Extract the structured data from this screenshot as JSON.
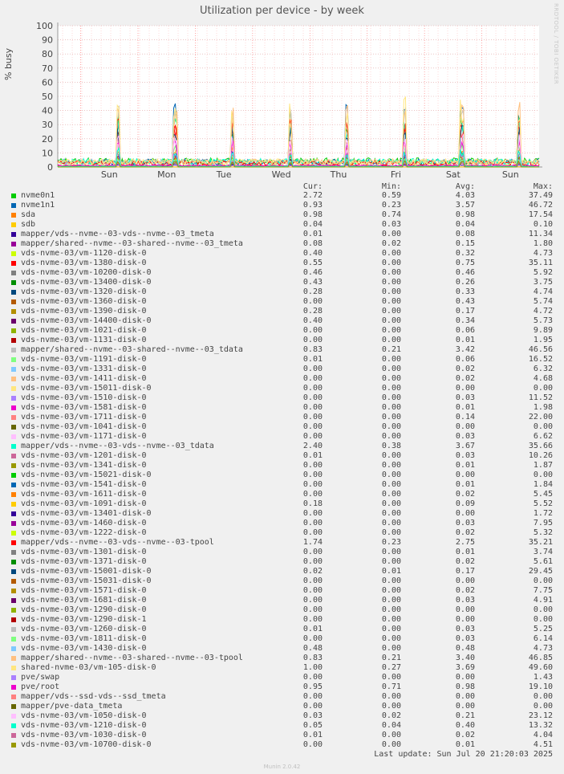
{
  "chart_data": {
    "type": "line",
    "title": "Utilization per device - by week",
    "ylabel": "% busy",
    "ylim": [
      0,
      100
    ],
    "yticks": [
      0,
      10,
      20,
      30,
      40,
      50,
      60,
      70,
      80,
      90,
      100
    ],
    "xticks": [
      "Sun",
      "Mon",
      "Tue",
      "Wed",
      "Thu",
      "Fri",
      "Sat",
      "Sun"
    ],
    "grid": true,
    "series": [
      {
        "name": "nvme0n1",
        "color": "#00cc00",
        "cur": "2.72",
        "min": "0.59",
        "avg": "4.03",
        "max": "37.49"
      },
      {
        "name": "nvme1n1",
        "color": "#0066b3",
        "cur": "0.93",
        "min": "0.23",
        "avg": "3.57",
        "max": "46.72"
      },
      {
        "name": "sda",
        "color": "#ff8000",
        "cur": "0.98",
        "min": "0.74",
        "avg": "0.98",
        "max": "17.54"
      },
      {
        "name": "sdb",
        "color": "#ffcc00",
        "cur": "0.04",
        "min": "0.03",
        "avg": "0.04",
        "max": "0.10"
      },
      {
        "name": "mapper/vds--nvme--03-vds--nvme--03_tmeta",
        "color": "#330099",
        "cur": "0.01",
        "min": "0.00",
        "avg": "0.08",
        "max": "11.34"
      },
      {
        "name": "mapper/shared--nvme--03-shared--nvme--03_tmeta",
        "color": "#990099",
        "cur": "0.08",
        "min": "0.02",
        "avg": "0.15",
        "max": "1.80"
      },
      {
        "name": "vds-nvme-03/vm-1120-disk-0",
        "color": "#ccff00",
        "cur": "0.40",
        "min": "0.00",
        "avg": "0.32",
        "max": "4.73"
      },
      {
        "name": "vds-nvme-03/vm-1380-disk-0",
        "color": "#ff0000",
        "cur": "0.55",
        "min": "0.00",
        "avg": "0.75",
        "max": "35.11"
      },
      {
        "name": "vds-nvme-03/vm-10200-disk-0",
        "color": "#808080",
        "cur": "0.46",
        "min": "0.00",
        "avg": "0.46",
        "max": "5.92"
      },
      {
        "name": "vds-nvme-03/vm-13400-disk-0",
        "color": "#008f00",
        "cur": "0.43",
        "min": "0.00",
        "avg": "0.26",
        "max": "3.75"
      },
      {
        "name": "vds-nvme-03/vm-1320-disk-0",
        "color": "#00487d",
        "cur": "0.28",
        "min": "0.00",
        "avg": "0.33",
        "max": "4.74"
      },
      {
        "name": "vds-nvme-03/vm-1360-disk-0",
        "color": "#b35a00",
        "cur": "0.00",
        "min": "0.00",
        "avg": "0.43",
        "max": "5.74"
      },
      {
        "name": "vds-nvme-03/vm-1390-disk-0",
        "color": "#b38f00",
        "cur": "0.28",
        "min": "0.00",
        "avg": "0.17",
        "max": "4.72"
      },
      {
        "name": "vds-nvme-03/vm-14400-disk-0",
        "color": "#6b006b",
        "cur": "0.40",
        "min": "0.00",
        "avg": "0.34",
        "max": "5.73"
      },
      {
        "name": "vds-nvme-03/vm-1021-disk-0",
        "color": "#8fb300",
        "cur": "0.00",
        "min": "0.00",
        "avg": "0.06",
        "max": "9.89"
      },
      {
        "name": "vds-nvme-03/vm-1131-disk-0",
        "color": "#b30000",
        "cur": "0.00",
        "min": "0.00",
        "avg": "0.01",
        "max": "1.95"
      },
      {
        "name": "mapper/shared--nvme--03-shared--nvme--03_tdata",
        "color": "#bebebe",
        "cur": "0.83",
        "min": "0.21",
        "avg": "3.42",
        "max": "46.56"
      },
      {
        "name": "vds-nvme-03/vm-1191-disk-0",
        "color": "#80ff80",
        "cur": "0.01",
        "min": "0.00",
        "avg": "0.06",
        "max": "16.52"
      },
      {
        "name": "vds-nvme-03/vm-1331-disk-0",
        "color": "#80c9ff",
        "cur": "0.00",
        "min": "0.00",
        "avg": "0.02",
        "max": "6.32"
      },
      {
        "name": "vds-nvme-03/vm-1411-disk-0",
        "color": "#ffc080",
        "cur": "0.00",
        "min": "0.00",
        "avg": "0.02",
        "max": "4.68"
      },
      {
        "name": "vds-nvme-03/vm-15011-disk-0",
        "color": "#ffe680",
        "cur": "0.00",
        "min": "0.00",
        "avg": "0.00",
        "max": "0.00"
      },
      {
        "name": "vds-nvme-03/vm-1510-disk-0",
        "color": "#aa80ff",
        "cur": "0.00",
        "min": "0.00",
        "avg": "0.03",
        "max": "11.52"
      },
      {
        "name": "vds-nvme-03/vm-1581-disk-0",
        "color": "#ee00cc",
        "cur": "0.00",
        "min": "0.00",
        "avg": "0.01",
        "max": "1.98"
      },
      {
        "name": "vds-nvme-03/vm-1711-disk-0",
        "color": "#ff8080",
        "cur": "0.00",
        "min": "0.00",
        "avg": "0.14",
        "max": "22.00"
      },
      {
        "name": "vds-nvme-03/vm-1041-disk-0",
        "color": "#666600",
        "cur": "0.00",
        "min": "0.00",
        "avg": "0.00",
        "max": "0.00"
      },
      {
        "name": "vds-nvme-03/vm-1171-disk-0",
        "color": "#ffbfff",
        "cur": "0.00",
        "min": "0.00",
        "avg": "0.03",
        "max": "6.62"
      },
      {
        "name": "mapper/vds--nvme--03-vds--nvme--03_tdata",
        "color": "#00ffcc",
        "cur": "2.40",
        "min": "0.38",
        "avg": "3.67",
        "max": "35.66"
      },
      {
        "name": "vds-nvme-03/vm-1201-disk-0",
        "color": "#cc6699",
        "cur": "0.01",
        "min": "0.00",
        "avg": "0.03",
        "max": "10.26"
      },
      {
        "name": "vds-nvme-03/vm-1341-disk-0",
        "color": "#999900",
        "cur": "0.00",
        "min": "0.00",
        "avg": "0.01",
        "max": "1.87"
      },
      {
        "name": "vds-nvme-03/vm-15021-disk-0",
        "color": "#00cc00",
        "cur": "0.00",
        "min": "0.00",
        "avg": "0.00",
        "max": "0.00"
      },
      {
        "name": "vds-nvme-03/vm-1541-disk-0",
        "color": "#0066b3",
        "cur": "0.00",
        "min": "0.00",
        "avg": "0.01",
        "max": "1.84"
      },
      {
        "name": "vds-nvme-03/vm-1611-disk-0",
        "color": "#ff8000",
        "cur": "0.00",
        "min": "0.00",
        "avg": "0.02",
        "max": "5.45"
      },
      {
        "name": "vds-nvme-03/vm-1091-disk-0",
        "color": "#ffcc00",
        "cur": "0.18",
        "min": "0.00",
        "avg": "0.09",
        "max": "5.52"
      },
      {
        "name": "vds-nvme-03/vm-13401-disk-0",
        "color": "#330099",
        "cur": "0.00",
        "min": "0.00",
        "avg": "0.00",
        "max": "1.72"
      },
      {
        "name": "vds-nvme-03/vm-1460-disk-0",
        "color": "#990099",
        "cur": "0.00",
        "min": "0.00",
        "avg": "0.03",
        "max": "7.95"
      },
      {
        "name": "vds-nvme-03/vm-1222-disk-0",
        "color": "#ccff00",
        "cur": "0.00",
        "min": "0.00",
        "avg": "0.02",
        "max": "5.32"
      },
      {
        "name": "mapper/vds--nvme--03-vds--nvme--03-tpool",
        "color": "#ff0000",
        "cur": "1.74",
        "min": "0.23",
        "avg": "2.75",
        "max": "35.21"
      },
      {
        "name": "vds-nvme-03/vm-1301-disk-0",
        "color": "#808080",
        "cur": "0.00",
        "min": "0.00",
        "avg": "0.01",
        "max": "3.74"
      },
      {
        "name": "vds-nvme-03/vm-1371-disk-0",
        "color": "#008f00",
        "cur": "0.00",
        "min": "0.00",
        "avg": "0.02",
        "max": "5.61"
      },
      {
        "name": "vds-nvme-03/vm-15001-disk-0",
        "color": "#00487d",
        "cur": "0.02",
        "min": "0.01",
        "avg": "0.17",
        "max": "29.45"
      },
      {
        "name": "vds-nvme-03/vm-15031-disk-0",
        "color": "#b35a00",
        "cur": "0.00",
        "min": "0.00",
        "avg": "0.00",
        "max": "0.00"
      },
      {
        "name": "vds-nvme-03/vm-1571-disk-0",
        "color": "#b38f00",
        "cur": "0.00",
        "min": "0.00",
        "avg": "0.02",
        "max": "7.75"
      },
      {
        "name": "vds-nvme-03/vm-1681-disk-0",
        "color": "#6b006b",
        "cur": "0.00",
        "min": "0.00",
        "avg": "0.03",
        "max": "4.91"
      },
      {
        "name": "vds-nvme-03/vm-1290-disk-0",
        "color": "#8fb300",
        "cur": "0.00",
        "min": "0.00",
        "avg": "0.00",
        "max": "0.00"
      },
      {
        "name": "vds-nvme-03/vm-1290-disk-1",
        "color": "#b30000",
        "cur": "0.00",
        "min": "0.00",
        "avg": "0.00",
        "max": "0.00"
      },
      {
        "name": "vds-nvme-03/vm-1260-disk-0",
        "color": "#bebebe",
        "cur": "0.01",
        "min": "0.00",
        "avg": "0.03",
        "max": "5.25"
      },
      {
        "name": "vds-nvme-03/vm-1811-disk-0",
        "color": "#80ff80",
        "cur": "0.00",
        "min": "0.00",
        "avg": "0.03",
        "max": "6.14"
      },
      {
        "name": "vds-nvme-03/vm-1430-disk-0",
        "color": "#80c9ff",
        "cur": "0.48",
        "min": "0.00",
        "avg": "0.48",
        "max": "4.73"
      },
      {
        "name": "mapper/shared--nvme--03-shared--nvme--03-tpool",
        "color": "#ffc080",
        "cur": "0.83",
        "min": "0.21",
        "avg": "3.40",
        "max": "46.85"
      },
      {
        "name": "shared-nvme-03/vm-105-disk-0",
        "color": "#ffe680",
        "cur": "1.00",
        "min": "0.27",
        "avg": "3.69",
        "max": "49.60"
      },
      {
        "name": "pve/swap",
        "color": "#aa80ff",
        "cur": "0.00",
        "min": "0.00",
        "avg": "0.00",
        "max": "1.43"
      },
      {
        "name": "pve/root",
        "color": "#ee00cc",
        "cur": "0.95",
        "min": "0.71",
        "avg": "0.98",
        "max": "19.10"
      },
      {
        "name": "mapper/vds--ssd-vds--ssd_tmeta",
        "color": "#ff8080",
        "cur": "0.00",
        "min": "0.00",
        "avg": "0.00",
        "max": "0.00"
      },
      {
        "name": "mapper/pve-data_tmeta",
        "color": "#666600",
        "cur": "0.00",
        "min": "0.00",
        "avg": "0.00",
        "max": "0.00"
      },
      {
        "name": "vds-nvme-03/vm-1050-disk-0",
        "color": "#ffbfff",
        "cur": "0.03",
        "min": "0.02",
        "avg": "0.21",
        "max": "23.12"
      },
      {
        "name": "vds-nvme-03/vm-1210-disk-0",
        "color": "#00ffcc",
        "cur": "0.05",
        "min": "0.04",
        "avg": "0.40",
        "max": "13.32"
      },
      {
        "name": "vds-nvme-03/vm-1030-disk-0",
        "color": "#cc6699",
        "cur": "0.01",
        "min": "0.00",
        "avg": "0.02",
        "max": "4.04"
      },
      {
        "name": "vds-nvme-03/vm-10700-disk-0",
        "color": "#999900",
        "cur": "0.00",
        "min": "0.00",
        "avg": "0.01",
        "max": "4.51"
      }
    ]
  },
  "legend_headers": {
    "cur": "Cur:",
    "min": "Min:",
    "avg": "Avg:",
    "max": "Max:"
  },
  "last_update": "Last update: Sun Jul 20 21:20:03 2025",
  "watermark": "RRDTOOL / TOBI OETIKER",
  "footer": "Munin 2.0.42"
}
